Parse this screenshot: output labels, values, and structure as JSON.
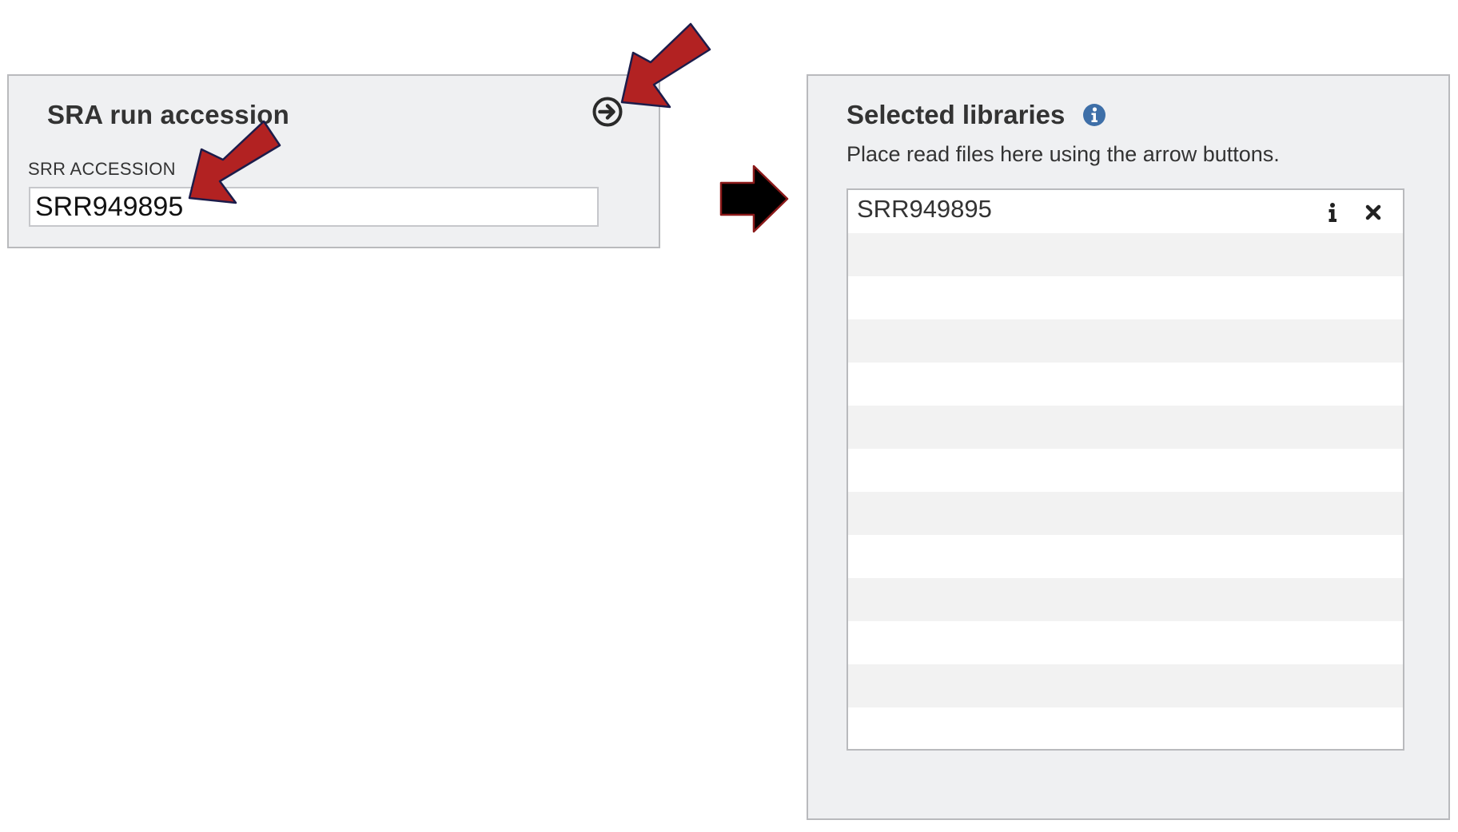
{
  "sra_panel": {
    "title": "SRA run accession",
    "field_label": "SRR ACCESSION",
    "field_value": "SRR949895",
    "add_icon": "arrow-circle-right-icon"
  },
  "libraries_panel": {
    "title": "Selected libraries",
    "info_icon": "info-circle-icon",
    "description": "Place read files here using the arrow buttons.",
    "items": [
      {
        "name": "SRR949895",
        "info_icon": "info-icon",
        "remove_icon": "close-icon"
      }
    ]
  },
  "annotation_arrow_color": "#b22222",
  "flow_arrow_color": "#000000"
}
